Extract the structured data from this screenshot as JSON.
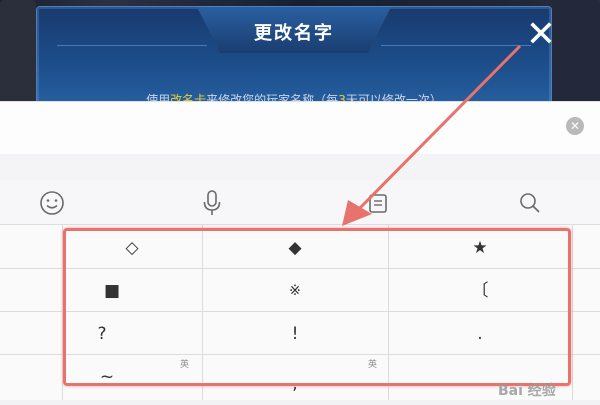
{
  "dialog": {
    "title": "更改名字",
    "close_glyph": "✕",
    "desc_prefix": "使用",
    "desc_highlight1": "改名卡",
    "desc_middle": "来修改您的玩家名称（每",
    "desc_highlight2": "3",
    "desc_suffix": "天可以修改一次）"
  },
  "input": {
    "value": "",
    "placeholder": "",
    "clear_icon": "clear-circle-icon"
  },
  "toolbar": {
    "icons": [
      "emoji-icon",
      "microphone-icon",
      "clipboard-icon",
      "search-icon"
    ]
  },
  "keyboard": {
    "rows": [
      [
        "◇",
        "◆",
        "★"
      ],
      [
        "■",
        "※",
        "〔"
      ],
      [
        "?",
        "!",
        "."
      ],
      [
        "~",
        ",",
        ""
      ]
    ],
    "sub_labels": {
      "row4_col1": "英",
      "row4_col2": "英"
    }
  },
  "annotation": {
    "arrow_color": "#e8736d",
    "box_color": "#e8736d"
  },
  "watermark": "Bai 经验"
}
